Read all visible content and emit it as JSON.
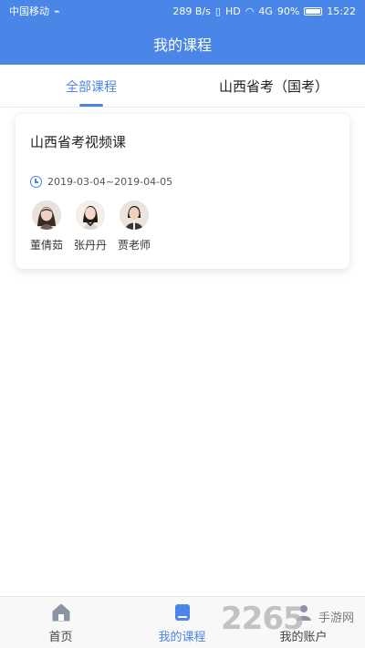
{
  "status_bar": {
    "carrier": "中国移动",
    "network_speed": "289 B/s",
    "hd": "HD",
    "signal": "4G",
    "battery": "90%",
    "time": "15:22"
  },
  "header": {
    "title": "我的课程"
  },
  "tabs": [
    {
      "label": "全部课程"
    },
    {
      "label": "山西省考（国考）"
    }
  ],
  "course": {
    "title": "山西省考视频课",
    "date_range": "2019-03-04~2019-04-05",
    "teachers": [
      {
        "name": "董倩茹"
      },
      {
        "name": "张丹丹"
      },
      {
        "name": "贾老师"
      }
    ]
  },
  "bottom_nav": [
    {
      "label": "首页",
      "icon": "home-icon"
    },
    {
      "label": "我的课程",
      "icon": "course-book-icon"
    },
    {
      "label": "我的账户",
      "icon": "account-icon"
    }
  ],
  "watermark": {
    "number": "2265",
    "text": "手游网"
  },
  "colors": {
    "primary": "#4a86e8",
    "background": "#ffffff",
    "tab_inactive": "#222222",
    "bottom_nav_background": "#f8f8f8"
  }
}
